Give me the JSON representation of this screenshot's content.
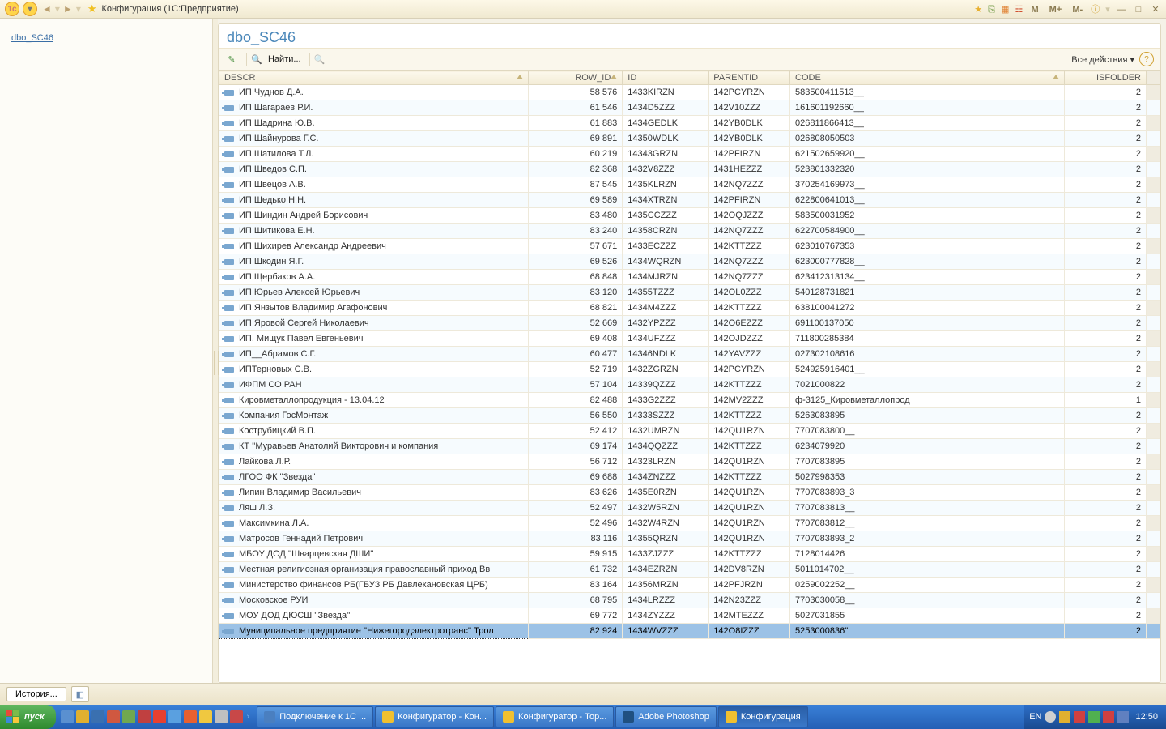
{
  "window": {
    "title": "Конфигурация  (1С:Предприятие)"
  },
  "titlebar_right": {
    "m1": "M",
    "m2": "M+",
    "m3": "M-"
  },
  "sidebar": {
    "link": "dbo_SC46"
  },
  "main": {
    "title": "dbo_SC46",
    "find_label": "Найти...",
    "all_actions": "Все действия"
  },
  "columns": {
    "descr": "DESCR",
    "row_id": "ROW_ID",
    "id": "ID",
    "parentid": "PARENTID",
    "code": "CODE",
    "isfolder": "ISFOLDER"
  },
  "chart_data": {
    "type": "table",
    "columns": [
      "DESCR",
      "ROW_ID",
      "ID",
      "PARENTID",
      "CODE",
      "ISFOLDER"
    ],
    "rows": [
      {
        "descr": "ИП Чуднов Д.А.",
        "row_id": "58 576",
        "id": "1433KIRZN",
        "parentid": "142PCYRZN",
        "code": "583500411513__",
        "isfolder": "2"
      },
      {
        "descr": "ИП Шагараев Р.И.",
        "row_id": "61 546",
        "id": "1434D5ZZZ",
        "parentid": "142V10ZZZ",
        "code": "161601192660__",
        "isfolder": "2"
      },
      {
        "descr": "ИП Шадрина Ю.В.",
        "row_id": "61 883",
        "id": "1434GEDLK",
        "parentid": "142YB0DLK",
        "code": "026811866413__",
        "isfolder": "2"
      },
      {
        "descr": "ИП Шайнурова Г.С.",
        "row_id": "69 891",
        "id": "14350WDLK",
        "parentid": "142YB0DLK",
        "code": "026808050503",
        "isfolder": "2"
      },
      {
        "descr": "ИП Шатилова Т.Л.",
        "row_id": "60 219",
        "id": "14343GRZN",
        "parentid": "142PFIRZN",
        "code": "621502659920__",
        "isfolder": "2"
      },
      {
        "descr": "ИП Шведов С.П.",
        "row_id": "82 368",
        "id": "1432V8ZZZ",
        "parentid": "1431HEZZZ",
        "code": "523801332320",
        "isfolder": "2"
      },
      {
        "descr": "ИП Швецов А.В.",
        "row_id": "87 545",
        "id": "1435KLRZN",
        "parentid": "142NQ7ZZZ",
        "code": "370254169973__",
        "isfolder": "2"
      },
      {
        "descr": "ИП Шедько Н.Н.",
        "row_id": "69 589",
        "id": "1434XTRZN",
        "parentid": "142PFIRZN",
        "code": "622800641013__",
        "isfolder": "2"
      },
      {
        "descr": "ИП Шиндин Андрей Борисович",
        "row_id": "83 480",
        "id": "1435CCZZZ",
        "parentid": "142OQJZZZ",
        "code": "583500031952",
        "isfolder": "2"
      },
      {
        "descr": "ИП Шитикова Е.Н.",
        "row_id": "83 240",
        "id": "14358CRZN",
        "parentid": "142NQ7ZZZ",
        "code": "622700584900__",
        "isfolder": "2"
      },
      {
        "descr": "ИП Шихирев Александр Андреевич",
        "row_id": "57 671",
        "id": "1433ECZZZ",
        "parentid": "142KTTZZZ",
        "code": "623010767353",
        "isfolder": "2"
      },
      {
        "descr": "ИП Шкодин Я.Г.",
        "row_id": "69 526",
        "id": "1434WQRZN",
        "parentid": "142NQ7ZZZ",
        "code": "623000777828__",
        "isfolder": "2"
      },
      {
        "descr": "ИП Щербаков А.А.",
        "row_id": "68 848",
        "id": "1434MJRZN",
        "parentid": "142NQ7ZZZ",
        "code": "623412313134__",
        "isfolder": "2"
      },
      {
        "descr": "ИП Юрьев Алексей Юрьевич",
        "row_id": "83 120",
        "id": "14355TZZZ",
        "parentid": "142OL0ZZZ",
        "code": "540128731821",
        "isfolder": "2"
      },
      {
        "descr": "ИП Янзытов Владимир Агафонович",
        "row_id": "68 821",
        "id": "1434M4ZZZ",
        "parentid": "142KTTZZZ",
        "code": "638100041272",
        "isfolder": "2"
      },
      {
        "descr": "ИП Яровой Сергей Николаевич",
        "row_id": "52 669",
        "id": "1432YPZZZ",
        "parentid": "142O6EZZZ",
        "code": "691100137050",
        "isfolder": "2"
      },
      {
        "descr": "ИП. Мищук Павел Евгеньевич",
        "row_id": "69 408",
        "id": "1434UFZZZ",
        "parentid": "142OJDZZZ",
        "code": "711800285384",
        "isfolder": "2"
      },
      {
        "descr": "ИП__Абрамов С.Г.",
        "row_id": "60 477",
        "id": "14346NDLK",
        "parentid": "142YAVZZZ",
        "code": "027302108616",
        "isfolder": "2"
      },
      {
        "descr": "ИПТерновых С.В.",
        "row_id": "52 719",
        "id": "1432ZGRZN",
        "parentid": "142PCYRZN",
        "code": "524925916401__",
        "isfolder": "2"
      },
      {
        "descr": "ИФПМ СО РАН",
        "row_id": "57 104",
        "id": "14339QZZZ",
        "parentid": "142KTTZZZ",
        "code": "7021000822",
        "isfolder": "2"
      },
      {
        "descr": "Кировметаллопродукция - 13.04.12",
        "row_id": "82 488",
        "id": "1433G2ZZZ",
        "parentid": "142MV2ZZZ",
        "code": "ф-3125_Кировметаллопрод",
        "isfolder": "1"
      },
      {
        "descr": "Компания ГосМонтаж",
        "row_id": "56 550",
        "id": "14333SZZZ",
        "parentid": "142KTTZZZ",
        "code": "5263083895",
        "isfolder": "2"
      },
      {
        "descr": "Кострубицкий  В.П.",
        "row_id": "52 412",
        "id": "1432UMRZN",
        "parentid": "142QU1RZN",
        "code": "7707083800__",
        "isfolder": "2"
      },
      {
        "descr": "КТ ''Муравьев Анатолий Викторович и компания",
        "row_id": "69 174",
        "id": "1434QQZZZ",
        "parentid": "142KTTZZZ",
        "code": "6234079920",
        "isfolder": "2"
      },
      {
        "descr": "Лайкова  Л.Р.",
        "row_id": "56 712",
        "id": "14323LRZN",
        "parentid": "142QU1RZN",
        "code": "7707083895",
        "isfolder": "2"
      },
      {
        "descr": "ЛГОО ФК ''Звезда''",
        "row_id": "69 688",
        "id": "1434ZNZZZ",
        "parentid": "142KTTZZZ",
        "code": "5027998353",
        "isfolder": "2"
      },
      {
        "descr": "Липин Владимир Васильевич",
        "row_id": "83 626",
        "id": "1435E0RZN",
        "parentid": "142QU1RZN",
        "code": "7707083893_3",
        "isfolder": "2"
      },
      {
        "descr": "Ляш Л.З.",
        "row_id": "52 497",
        "id": "1432W5RZN",
        "parentid": "142QU1RZN",
        "code": "7707083813__",
        "isfolder": "2"
      },
      {
        "descr": "Максимкина Л.А.",
        "row_id": "52 496",
        "id": "1432W4RZN",
        "parentid": "142QU1RZN",
        "code": "7707083812__",
        "isfolder": "2"
      },
      {
        "descr": "Матросов Геннадий Петрович",
        "row_id": "83 116",
        "id": "14355QRZN",
        "parentid": "142QU1RZN",
        "code": "7707083893_2",
        "isfolder": "2"
      },
      {
        "descr": "МБОУ ДОД ''Шварцевская ДШИ''",
        "row_id": "59 915",
        "id": "1433ZJZZZ",
        "parentid": "142KTTZZZ",
        "code": "7128014426",
        "isfolder": "2"
      },
      {
        "descr": "Местная религиозная организация православный приход Вв",
        "row_id": "61 732",
        "id": "1434EZRZN",
        "parentid": "142DV8RZN",
        "code": "5011014702__",
        "isfolder": "2"
      },
      {
        "descr": "Министерство финансов РБ(ГБУЗ РБ Давлекановская ЦРБ)",
        "row_id": "83 164",
        "id": "14356MRZN",
        "parentid": "142PFJRZN",
        "code": "0259002252__",
        "isfolder": "2"
      },
      {
        "descr": "Московское РУИ",
        "row_id": "68 795",
        "id": "1434LRZZZ",
        "parentid": "142N23ZZZ",
        "code": "7703030058__",
        "isfolder": "2"
      },
      {
        "descr": "МОУ ДОД ДЮСШ ''Звезда''",
        "row_id": "69 772",
        "id": "1434ZYZZZ",
        "parentid": "142MTEZZZ",
        "code": "5027031855",
        "isfolder": "2"
      },
      {
        "descr": "Муниципальное предприятие ''Нижегородэлектротранс'' Трол",
        "row_id": "82 924",
        "id": "1434WVZZZ",
        "parentid": "142O8IZZZ",
        "code": "5253000836''",
        "isfolder": "2",
        "selected": true
      }
    ]
  },
  "statusbar": {
    "history": "История..."
  },
  "taskbar": {
    "start": "пуск",
    "tasks": [
      {
        "label": "Подключение к 1С ...",
        "color": "#4a7fc0"
      },
      {
        "label": "Конфигуратор - Кон...",
        "color": "#f0c030"
      },
      {
        "label": "Конфигуратор - Тор...",
        "color": "#f0c030"
      },
      {
        "label": "Adobe Photoshop",
        "color": "#205080"
      },
      {
        "label": "Конфигурация",
        "color": "#f0c030",
        "active": true
      }
    ],
    "lang": "EN",
    "clock": "12:50"
  }
}
